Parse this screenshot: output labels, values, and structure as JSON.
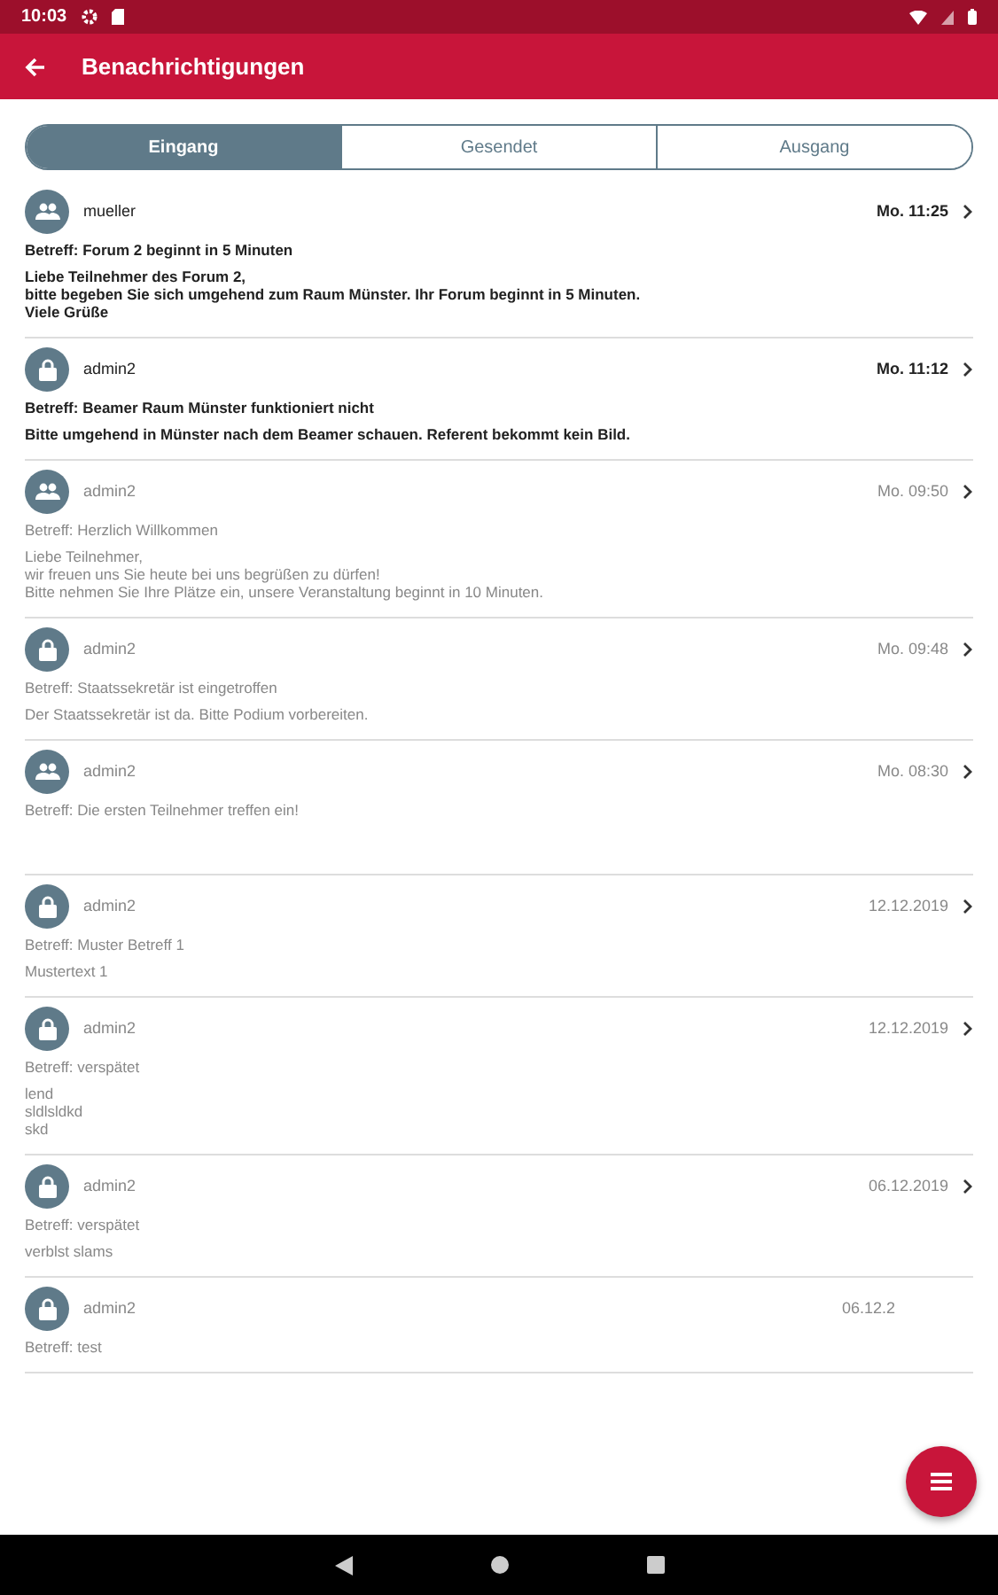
{
  "status_bar": {
    "time": "10:03"
  },
  "app_bar": {
    "title": "Benachrichtigungen"
  },
  "tabs": [
    {
      "label": "Eingang",
      "selected": true
    },
    {
      "label": "Gesendet",
      "selected": false
    },
    {
      "label": "Ausgang",
      "selected": false
    }
  ],
  "messages": [
    {
      "kind": "group",
      "sender": "mueller",
      "date": "Mo. 11:25",
      "unread": true,
      "subject": "Betreff: Forum 2 beginnt in 5 Minuten",
      "body": [
        "Liebe Teilnehmer des Forum 2,",
        "bitte begeben Sie sich umgehend zum Raum Münster. Ihr Forum beginnt in 5 Minuten.",
        "Viele Grüße"
      ]
    },
    {
      "kind": "lock",
      "sender": "admin2",
      "date": "Mo. 11:12",
      "unread": true,
      "subject": "Betreff: Beamer Raum Münster funktioniert nicht",
      "body": [
        "Bitte umgehend in Münster nach dem Beamer schauen. Referent bekommt kein Bild."
      ]
    },
    {
      "kind": "group",
      "sender": "admin2",
      "date": "Mo. 09:50",
      "unread": false,
      "subject": "Betreff: Herzlich Willkommen",
      "body": [
        "Liebe Teilnehmer,",
        "wir freuen uns Sie heute bei uns begrüßen zu dürfen!",
        "Bitte nehmen Sie Ihre Plätze ein, unsere Veranstaltung beginnt in 10 Minuten."
      ]
    },
    {
      "kind": "lock",
      "sender": "admin2",
      "date": "Mo. 09:48",
      "unread": false,
      "subject": "Betreff: Staatssekretär ist eingetroffen",
      "body": [
        "Der Staatssekretär ist da. Bitte Podium vorbereiten."
      ]
    },
    {
      "kind": "group",
      "sender": "admin2",
      "date": "Mo. 08:30",
      "unread": false,
      "subject": "Betreff: Die ersten Teilnehmer treffen ein!"
    },
    {
      "kind": "lock",
      "sender": "admin2",
      "date": "12.12.2019",
      "unread": false,
      "subject": "Betreff: Muster Betreff 1",
      "body": [
        "Mustertext 1"
      ]
    },
    {
      "kind": "lock",
      "sender": "admin2",
      "date": "12.12.2019",
      "unread": false,
      "subject": "Betreff: verspätet",
      "body": [
        "lend",
        "sldlsldkd",
        "skd"
      ]
    },
    {
      "kind": "lock",
      "sender": "admin2",
      "date": "06.12.2019",
      "unread": false,
      "subject": "Betreff: verspätet",
      "body": [
        "verblst slams"
      ]
    },
    {
      "kind": "lock",
      "sender": "admin2",
      "date": "06.12.2",
      "unread": false,
      "subject": "Betreff: test"
    }
  ]
}
